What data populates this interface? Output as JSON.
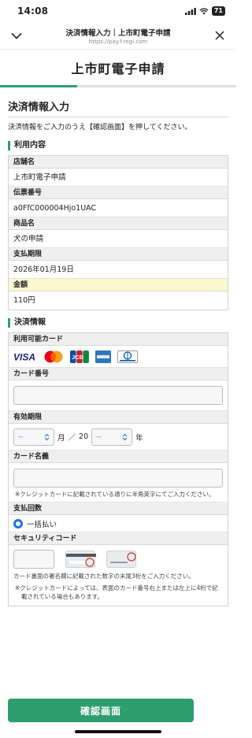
{
  "status": {
    "time": "14:08",
    "battery": "71"
  },
  "browser": {
    "title": "決済情報入力｜上市町電子申請",
    "url": "https://pay.f-regi.com"
  },
  "header": {
    "title": "上市町電子申請"
  },
  "page": {
    "heading": "決済情報入力",
    "intro": "決済情報をご入力のうえ【確認画面】を押してください。"
  },
  "usage": {
    "section_label": "利用内容",
    "rows": [
      {
        "label": "店舗名",
        "value": "上市町電子申請"
      },
      {
        "label": "伝票番号",
        "value": "a0FfC000004Hjo1UAC"
      },
      {
        "label": "商品名",
        "value": "犬の申請"
      },
      {
        "label": "支払期限",
        "value": "2026年01月19日"
      },
      {
        "label": "金額",
        "value": "110円"
      }
    ]
  },
  "payment": {
    "section_label": "決済情報",
    "cards_label": "利用可能カード",
    "cards": [
      "VISA",
      "JCB",
      "Diners Club INTERNATIONAL"
    ],
    "card_number_label": "カード番号",
    "expiry_label": "有効期限",
    "expiry_month": "--",
    "expiry_month_suffix": "月",
    "expiry_sep": "／",
    "expiry_year_prefix": "20",
    "expiry_year": "--",
    "expiry_year_suffix": "年",
    "name_label": "カード名義",
    "name_note": "※クレジットカードに記載されている通りに半角英字にてご入力ください。",
    "installments_label": "支払回数",
    "installments_option": "一括払い",
    "security_label": "セキュリティコード",
    "security_note1": "カード裏面の署名欄に記載された数字の末尾3桁をご入力ください。",
    "security_note2": "※クレジットカードによっては、表面のカード番号右上または左上に4桁で記載されている場合もあります。"
  },
  "confirm": {
    "label": "確認画面"
  },
  "colors": {
    "accent": "#2f9e6e",
    "radio": "#1a73e8"
  }
}
